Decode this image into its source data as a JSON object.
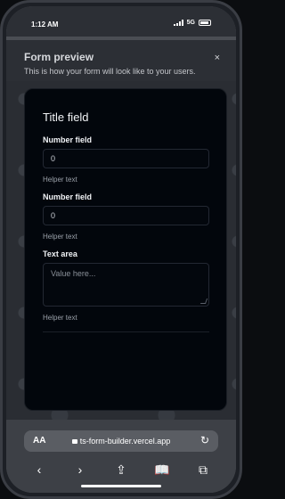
{
  "status": {
    "time": "1:12 AM",
    "network": "5G"
  },
  "sheet": {
    "title": "Form preview",
    "subtitle": "This is how your form will look like to your users.",
    "close_icon": "×"
  },
  "form": {
    "title": "Title field",
    "fields": [
      {
        "label": "Number field",
        "value": "0",
        "helper": "Helper text"
      },
      {
        "label": "Number field",
        "value": "0",
        "helper": "Helper text"
      }
    ],
    "textarea": {
      "label": "Text area",
      "placeholder": "Value here...",
      "helper": "Helper text"
    }
  },
  "browser": {
    "aa_label": "AA",
    "url": "ts-form-builder.vercel.app",
    "icons": [
      "back-icon",
      "forward-icon",
      "share-icon",
      "bookmarks-icon",
      "tabs-icon"
    ]
  }
}
